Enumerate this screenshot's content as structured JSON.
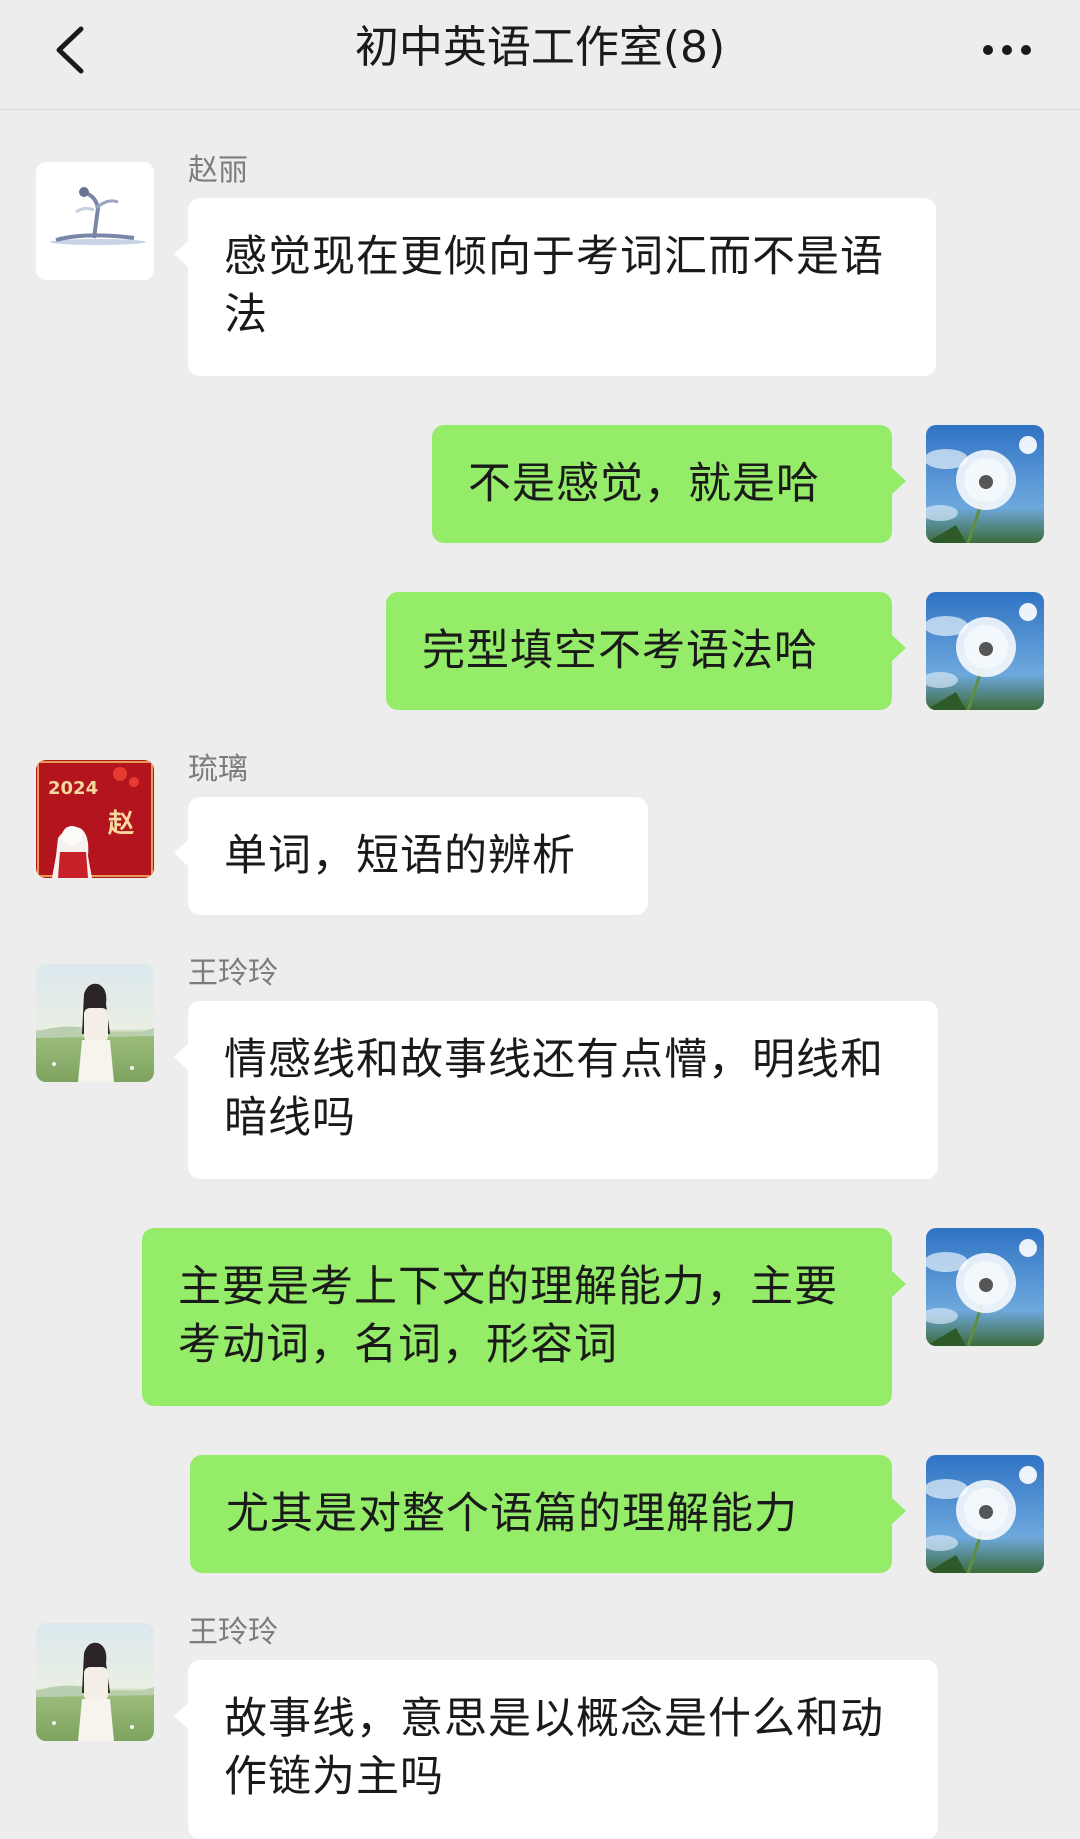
{
  "header": {
    "title": "初中英语工作室(8)"
  },
  "messages": [
    {
      "sender": "赵丽",
      "text": "感觉现在更倾向于考词汇而不是语法"
    },
    {
      "text": "不是感觉，就是哈"
    },
    {
      "text": "完型填空不考语法哈"
    },
    {
      "sender": "琉璃",
      "text": "单词，短语的辨析"
    },
    {
      "sender": "王玲玲",
      "text": "情感线和故事线还有点懵，明线和暗线吗"
    },
    {
      "text": "主要是考上下文的理解能力，主要考动词，名词，形容词"
    },
    {
      "text": "尤其是对整个语篇的理解能力"
    },
    {
      "sender": "王玲玲",
      "text": "故事线，意思是以概念是什么和动作链为主吗"
    }
  ],
  "avatars": {
    "liuli_badge_year": "2024",
    "liuli_badge_char": "赵"
  },
  "colors": {
    "outgoing_bubble": "#95ec69",
    "incoming_bubble": "#ffffff",
    "background": "#ededed"
  }
}
